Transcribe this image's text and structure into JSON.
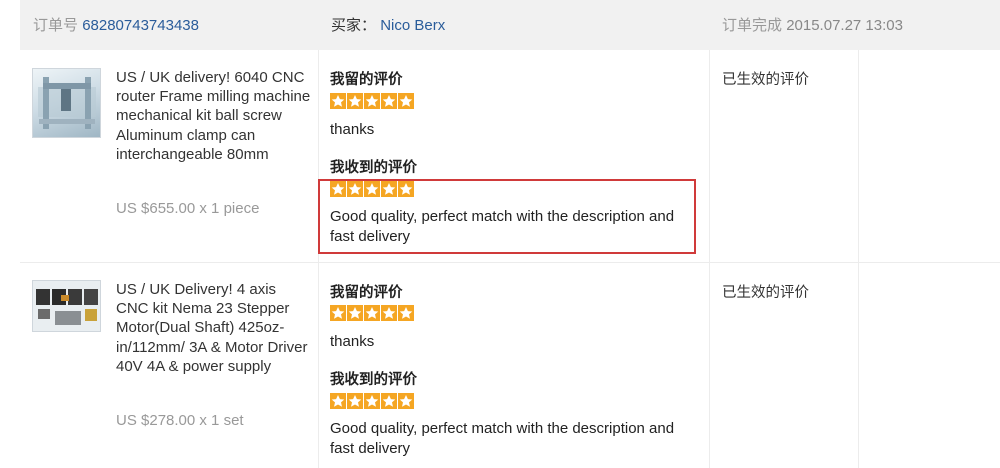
{
  "header": {
    "order_label": "订单号",
    "order_number": "68280743743438",
    "buyer_label": "买家：",
    "buyer_name": "Nico Berx",
    "order_status": "订单完成",
    "order_date": "2015.07.27 13:03"
  },
  "orders": [
    {
      "title": "US / UK delivery! 6040 CNC router Frame milling machine mechanical kit ball screw Aluminum clamp can interchangeable 80mm",
      "price": "US $655.00 x 1 piece",
      "my_feedback_label": "我留的评价",
      "my_rating": 5,
      "my_comment": "thanks",
      "received_feedback_label": "我收到的评价",
      "received_rating": 5,
      "received_comment": "Good quality, perfect match with the description and fast delivery",
      "status": "已生效的评价"
    },
    {
      "title": "US / UK Delivery! 4 axis CNC kit Nema 23 Stepper Motor(Dual Shaft) 425oz-in/112mm/ 3A & Motor Driver 40V 4A & power supply",
      "price": "US $278.00 x 1 set",
      "my_feedback_label": "我留的评价",
      "my_rating": 5,
      "my_comment": "thanks",
      "received_feedback_label": "我收到的评价",
      "received_rating": 5,
      "received_comment": "Good quality, perfect match with the description and fast delivery",
      "status": "已生效的评价"
    }
  ],
  "colors": {
    "star": "#f5a623",
    "highlight_border": "#d03a3a",
    "link": "#2a5c9a",
    "header_bg": "#f1f1f1"
  },
  "icons": [
    "star-icon",
    "product-thumbnail"
  ]
}
